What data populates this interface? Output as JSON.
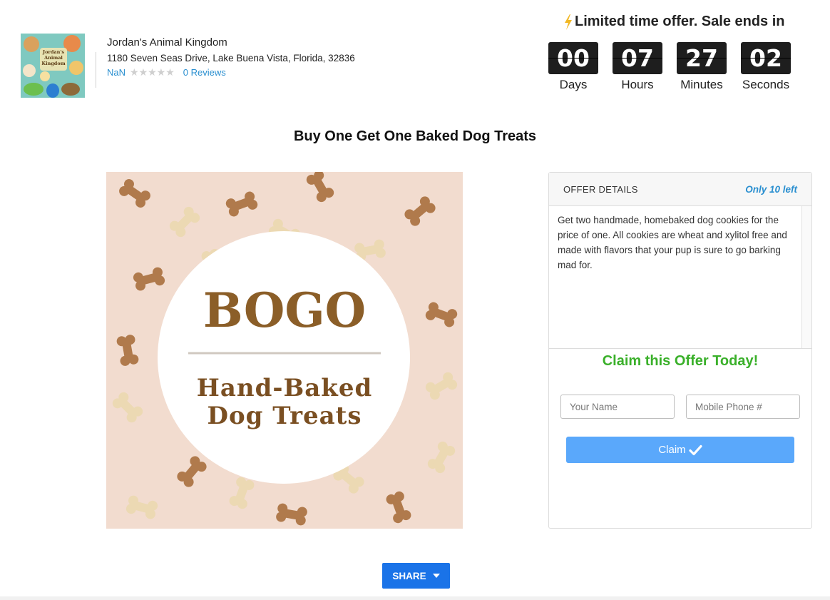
{
  "store": {
    "name": "Jordan's Animal Kingdom",
    "address": "1180 Seven Seas Drive, Lake Buena Vista, Florida, 32836",
    "rating": "NaN",
    "stars": "★★★★★",
    "reviews": "0 Reviews",
    "logo_text": "Jordan's Animal Kingdom"
  },
  "countdown": {
    "headline": "Limited time offer. Sale ends in",
    "units": [
      {
        "value": "00",
        "label": "Days"
      },
      {
        "value": "07",
        "label": "Hours"
      },
      {
        "value": "27",
        "label": "Minutes"
      },
      {
        "value": "02",
        "label": "Seconds"
      }
    ]
  },
  "offer": {
    "title": "Buy One Get One Baked Dog Treats",
    "image": {
      "headline": "BOGO",
      "line1": "Hand-Baked",
      "line2": "Dog Treats"
    },
    "details_title": "OFFER DETAILS",
    "remaining": "Only 10 left",
    "description": "Get two handmade, homebaked dog cookies for the price of one. All cookies are wheat and xylitol free and made with flavors that your pup is sure to go barking mad for."
  },
  "claim": {
    "heading": "Claim this Offer Today!",
    "name_placeholder": "Your Name",
    "phone_placeholder": "Mobile Phone #",
    "button_label": "Claim"
  },
  "share": {
    "label": "SHARE"
  },
  "colors": {
    "accent_blue": "#2a8fd0",
    "claim_green": "#3ab02a",
    "claim_button": "#5aa8fb",
    "share_button": "#1a73e8",
    "countdown_bg": "#1e1e1e",
    "bolt": "#f2b824",
    "bogo_brown": "#8b5e28"
  }
}
